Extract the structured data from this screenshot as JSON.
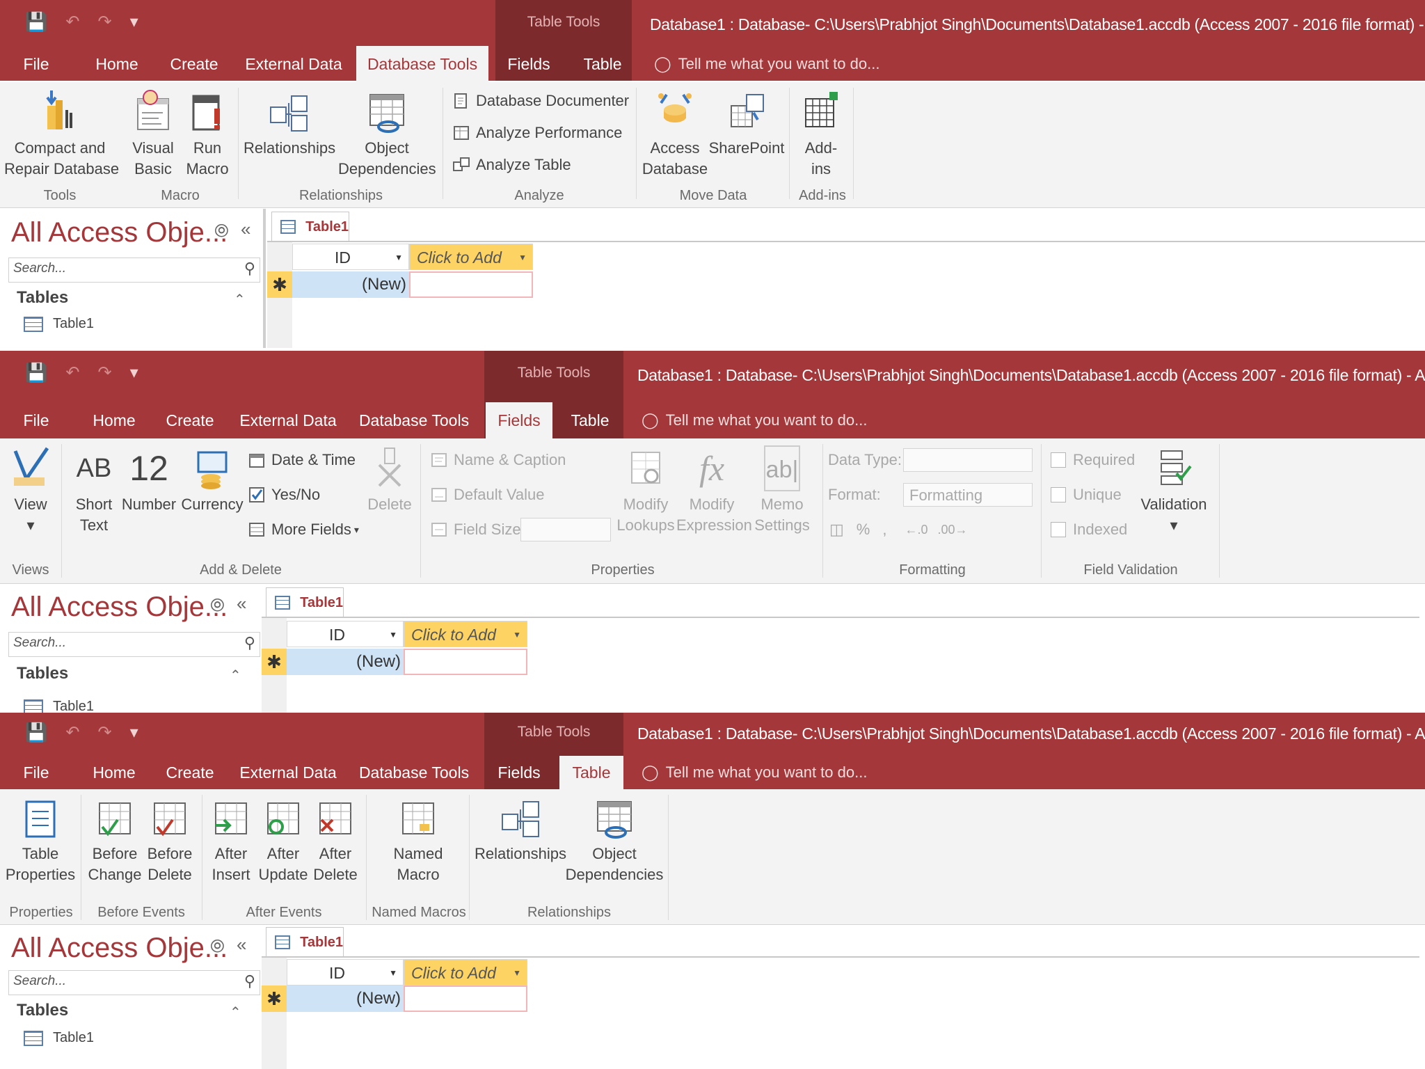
{
  "qat": {
    "save_icon": "save-icon",
    "undo_icon": "undo-icon",
    "redo_icon": "redo-icon",
    "customize_icon": "customize-icon"
  },
  "window": {
    "context_group": "Table Tools",
    "title": "Database1 : Database- C:\\Users\\Prabhjot Singh\\Documents\\Database1.accdb (Access 2007 - 2016 file format) - Access",
    "tell_me": "Tell me what you want to do..."
  },
  "tabs": [
    "File",
    "Home",
    "Create",
    "External Data",
    "Database Tools",
    "Fields",
    "Table"
  ],
  "colors": {
    "title_bar": "#a4373a",
    "context_group": "#7c2a2c",
    "ribbon": "#f3f3f3",
    "accent": "#a4373a",
    "header_highlight": "#fdd464",
    "new_row": "#cfe3f6"
  },
  "panel1": {
    "active_tab": "Database Tools",
    "buttons": {
      "compact": [
        "Compact and",
        "Repair Database"
      ],
      "visual_basic": [
        "Visual",
        "Basic"
      ],
      "run_macro": [
        "Run",
        "Macro"
      ],
      "relationships": [
        "Relationships"
      ],
      "object_dependencies": [
        "Object",
        "Dependencies"
      ],
      "access_database": [
        "Access",
        "Database"
      ],
      "sharepoint": [
        "SharePoint"
      ],
      "addins": [
        "Add-",
        "ins"
      ]
    },
    "analyze_items": [
      "Database Documenter",
      "Analyze Performance",
      "Analyze Table"
    ],
    "groups": [
      "Tools",
      "Macro",
      "Relationships",
      "Analyze",
      "Move Data",
      "Add-ins"
    ]
  },
  "panel2": {
    "active_tab": "Fields",
    "buttons": {
      "view": [
        "View"
      ],
      "short_text": [
        "Short",
        "Text"
      ],
      "number": [
        "Number"
      ],
      "currency": [
        "Currency"
      ],
      "delete": [
        "Delete"
      ],
      "modify_lookups": [
        "Modify",
        "Lookups"
      ],
      "modify_expression": [
        "Modify",
        "Expression"
      ],
      "memo_settings": [
        "Memo",
        "Settings"
      ],
      "validation": [
        "Validation"
      ]
    },
    "icon_text": {
      "short_text": "AB",
      "number": "12",
      "expression": "fx",
      "memo": "ab|"
    },
    "add_delete_items": [
      "Date & Time",
      "Yes/No",
      "More Fields"
    ],
    "properties_items": [
      "Name & Caption",
      "Default Value",
      "Field Size"
    ],
    "data_type_label": "Data Type:",
    "format_label": "Format:",
    "format_value": "Formatting",
    "validation_checks": [
      "Required",
      "Unique",
      "Indexed"
    ],
    "number_format_symbols": [
      "%",
      ","
    ],
    "groups": [
      "Views",
      "Add & Delete",
      "Properties",
      "Formatting",
      "Field Validation"
    ]
  },
  "panel3": {
    "active_tab": "Table",
    "buttons": {
      "table_properties": [
        "Table",
        "Properties"
      ],
      "before_change": [
        "Before",
        "Change"
      ],
      "before_delete": [
        "Before",
        "Delete"
      ],
      "after_insert": [
        "After",
        "Insert"
      ],
      "after_update": [
        "After",
        "Update"
      ],
      "after_delete": [
        "After",
        "Delete"
      ],
      "named_macro": [
        "Named",
        "Macro"
      ],
      "relationships": [
        "Relationships"
      ],
      "object_dependencies": [
        "Object",
        "Dependencies"
      ]
    },
    "groups": [
      "Properties",
      "Before Events",
      "After Events",
      "Named Macros",
      "Relationships"
    ]
  },
  "nav": {
    "title": "All Access Obje...",
    "search_placeholder": "Search...",
    "section": "Tables",
    "items": [
      "Table1"
    ]
  },
  "datasheet": {
    "tab": "Table1",
    "columns": [
      "ID",
      "Click to Add"
    ],
    "new_row": "(New)",
    "new_row_marker": "✱"
  }
}
